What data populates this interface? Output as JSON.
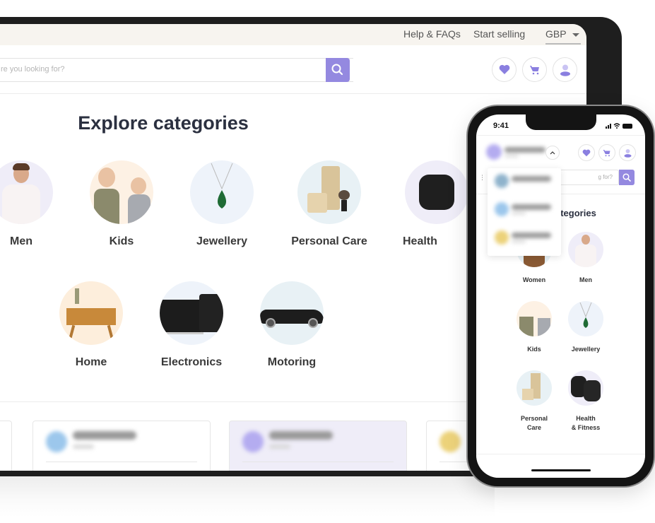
{
  "desktop": {
    "topbar": {
      "help_label": "Help & FAQs",
      "sell_label": "Start selling",
      "currency": "GBP"
    },
    "search": {
      "placeholder": "re you looking for?"
    },
    "header_icons": [
      "heart-icon",
      "cart-icon",
      "user-icon"
    ],
    "title": "Explore categories",
    "categories": [
      {
        "label": "Men",
        "bg": "#efedf8"
      },
      {
        "label": "Kids",
        "bg": "#fdf1e4"
      },
      {
        "label": "Jewellery",
        "bg": "#eef3fa"
      },
      {
        "label": "Personal Care",
        "bg": "#e8f1f5"
      },
      {
        "label": "Health",
        "bg": "#efedf8"
      },
      {
        "label": "Home",
        "bg": "#fdeedc"
      },
      {
        "label": "Electronics",
        "bg": "#eef3fa"
      },
      {
        "label": "Motoring",
        "bg": "#e8f1f5"
      }
    ],
    "brand_cards": [
      {
        "logo_color": "#9cc7ec",
        "active": false
      },
      {
        "logo_color": "#b4acf0",
        "active": true
      },
      {
        "logo_color": "#ecd27a",
        "active": false
      }
    ]
  },
  "mobile": {
    "status": {
      "time": "9:41",
      "indicators": "▂▄▆ ≋ ▬"
    },
    "search": {
      "placeholder": "g for?"
    },
    "dropdown_items": [
      {
        "logo_color": "#8fb3cc"
      },
      {
        "logo_color": "#9cc7ec"
      },
      {
        "logo_color": "#ecd27a"
      }
    ],
    "title": "ategories",
    "categories": [
      {
        "label": "Women",
        "bg": "#e8f1f5"
      },
      {
        "label": "Men",
        "bg": "#efedf8"
      },
      {
        "label": "Kids",
        "bg": "#fdf1e4"
      },
      {
        "label": "Jewellery",
        "bg": "#eef3fa"
      },
      {
        "label": "Personal Care",
        "bg": "#e8f1f5"
      },
      {
        "label": "Health & Fitness",
        "bg": "#efedf8"
      }
    ]
  },
  "colors": {
    "accent": "#9489e0",
    "icon": "#8a7fe0"
  }
}
